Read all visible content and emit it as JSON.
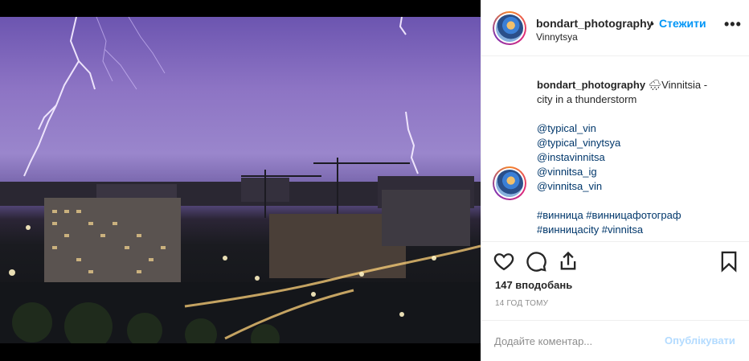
{
  "post": {
    "username": "bondart_photography",
    "separator": "•",
    "follow_label": "Стежити",
    "location": "Vinnytsya",
    "more_icon": "more-horizontal-icon"
  },
  "caption": {
    "username": "bondart_photography",
    "text_line1": "🌧Vinnitsia -",
    "text_line2": "city in a thunderstorm",
    "mentions": [
      "@typical_vin",
      "@typical_vinytsya",
      "@instavinnitsa",
      "@vinnitsa_ig",
      "@vinnitsa_vin"
    ],
    "hashtags_line1": "#винница #винницафотограф",
    "hashtags_line2": "#винницаcity #vinnitsa"
  },
  "actions": {
    "like_icon": "heart-icon",
    "comment_icon": "comment-icon",
    "share_icon": "share-icon",
    "save_icon": "bookmark-icon"
  },
  "stats": {
    "likes": "147 вподобань",
    "time": "14 ГОД ТОМУ"
  },
  "comment": {
    "placeholder": "Додайте коментар...",
    "publish_label": "Опублікувати"
  },
  "colors": {
    "accent": "#0095f6",
    "publish_disabled": "#b3dbff",
    "link": "#00376b"
  }
}
